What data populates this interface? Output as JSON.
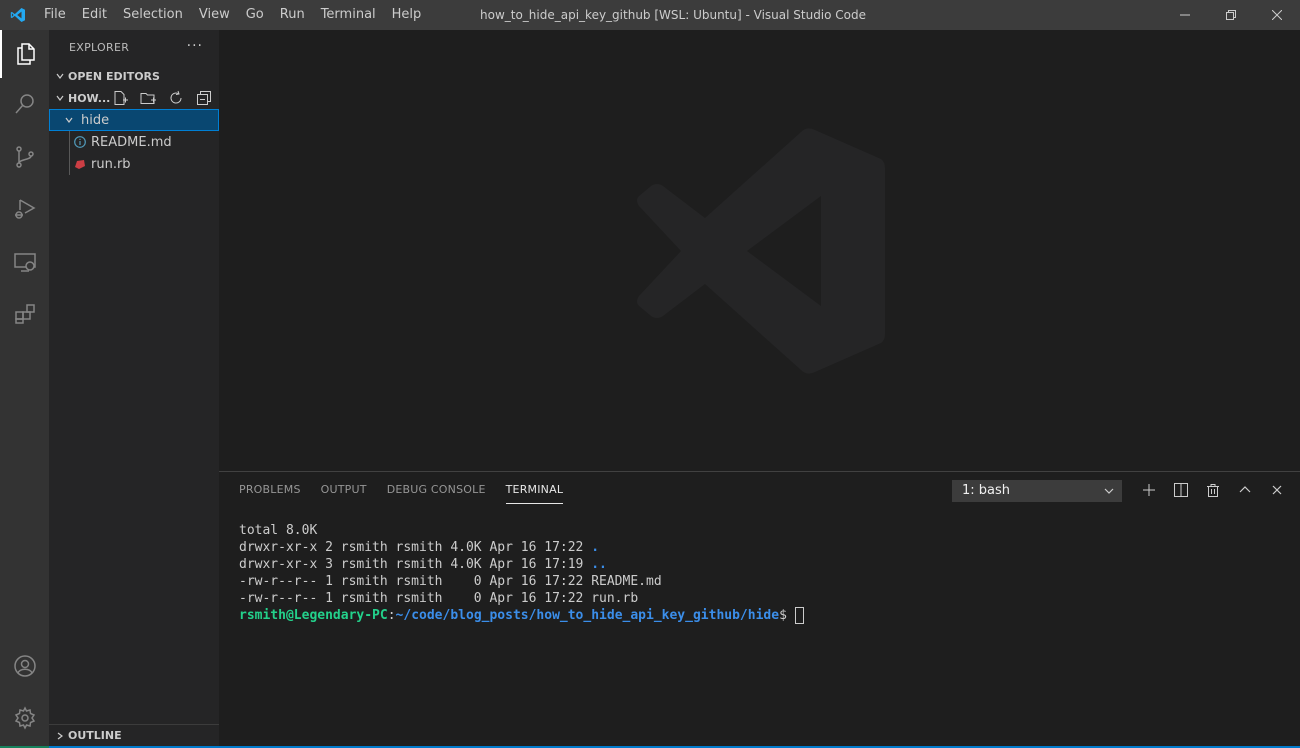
{
  "titlebar": {
    "title": "how_to_hide_api_key_github [WSL: Ubuntu] - Visual Studio Code",
    "menu": [
      "File",
      "Edit",
      "Selection",
      "View",
      "Go",
      "Run",
      "Terminal",
      "Help"
    ]
  },
  "activitybar": {
    "items": [
      "explorer-icon",
      "search-icon",
      "source-control-icon",
      "run-debug-icon",
      "remote-explorer-icon",
      "extensions-icon"
    ],
    "bottom": [
      "account-icon",
      "manage-gear-icon"
    ]
  },
  "sidebar": {
    "title": "EXPLORER",
    "more": "···",
    "open_editors": "OPEN EDITORS",
    "folder": "HOW...",
    "tree": [
      {
        "label": "hide",
        "type": "folder",
        "expanded": true,
        "selected": true
      },
      {
        "label": "README.md",
        "type": "file",
        "icon": "info-icon"
      },
      {
        "label": "run.rb",
        "type": "file",
        "icon": "ruby-icon"
      }
    ],
    "outline": "OUTLINE"
  },
  "panel": {
    "tabs": [
      "PROBLEMS",
      "OUTPUT",
      "DEBUG CONSOLE",
      "TERMINAL"
    ],
    "active_tab": "TERMINAL",
    "terminal_select": "1: bash",
    "terminal": {
      "lines": [
        "total 8.0K",
        "drwxr-xr-x 2 rsmith rsmith 4.0K Apr 16 17:22 ",
        "drwxr-xr-x 3 rsmith rsmith 4.0K Apr 16 17:19 ",
        "-rw-r--r-- 1 rsmith rsmith    0 Apr 16 17:22 README.md",
        "-rw-r--r-- 1 rsmith rsmith    0 Apr 16 17:22 run.rb"
      ],
      "dir_entries": [
        ".",
        ".."
      ],
      "prompt_user": "rsmith@Legendary-PC",
      "prompt_sep": ":",
      "prompt_path": "~/code/blog_posts/how_to_hide_api_key_github/hide",
      "prompt_symbol": "$ "
    }
  },
  "colors": {
    "accent": "#007acc",
    "prompt_user": "#23d18b",
    "prompt_path": "#3b8eea",
    "selection": "#094771"
  }
}
